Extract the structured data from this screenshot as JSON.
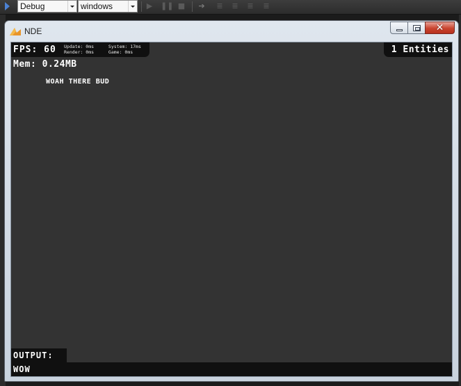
{
  "ide": {
    "config_value": "Debug",
    "platform_value": "windows"
  },
  "window": {
    "title": "NDE",
    "close_glyph": "✕"
  },
  "hud": {
    "fps": "FPS: 60",
    "timings": {
      "update": "Update: 0ms",
      "system": "System: 17ms",
      "render": "Render: 0ms",
      "game": "Game: 0ms"
    },
    "entities": "1 Entities",
    "mem": "Mem: 0.24MB",
    "message": "WOAH THERE BUD"
  },
  "console": {
    "label": "OUTPUT:",
    "value": "WOW"
  },
  "icons": {
    "app": "nde-app-icon",
    "start": "start-debug-icon",
    "pause": "pause-icon",
    "stop": "stop-icon",
    "step": "step-over-icon"
  },
  "colors": {
    "canvas_bg": "#333333",
    "panel_bg": "#101010",
    "hud_text": "#ffffff",
    "close_red": "#c9442f"
  }
}
